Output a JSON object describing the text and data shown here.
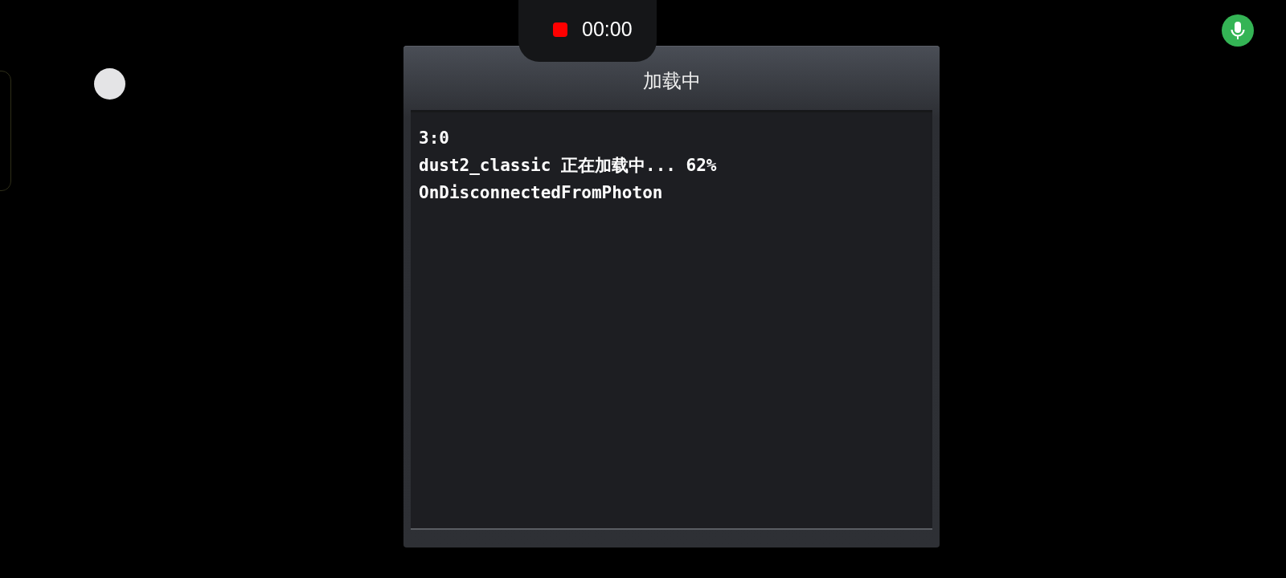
{
  "recording": {
    "timer": "00:00"
  },
  "dialog": {
    "title": "加载中",
    "log_lines": [
      "3:0",
      "dust2_classic 正在加载中... 62%",
      "OnDisconnectedFromPhoton"
    ]
  }
}
